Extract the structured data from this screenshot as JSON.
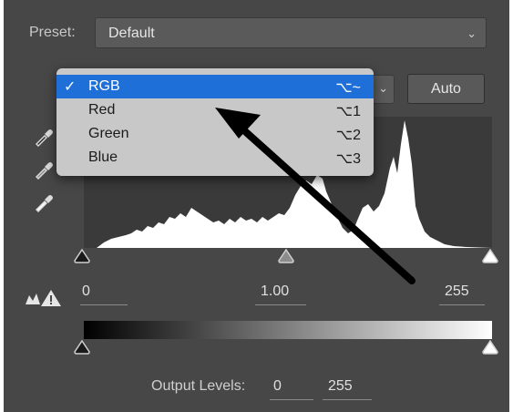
{
  "preset": {
    "label": "Preset:",
    "value": "Default"
  },
  "auto_button": "Auto",
  "channel_menu": {
    "items": [
      {
        "name": "RGB",
        "shortcut": "⌥~",
        "selected": true,
        "check": "✓"
      },
      {
        "name": "Red",
        "shortcut": "⌥1",
        "selected": false,
        "check": ""
      },
      {
        "name": "Green",
        "shortcut": "⌥2",
        "selected": false,
        "check": ""
      },
      {
        "name": "Blue",
        "shortcut": "⌥3",
        "selected": false,
        "check": ""
      }
    ]
  },
  "input_levels": {
    "black": "0",
    "gamma": "1.00",
    "white": "255"
  },
  "output_levels": {
    "label": "Output Levels:",
    "black": "0",
    "white": "255"
  },
  "colors": {
    "panel": "#474747",
    "menu_highlight": "#1f6fd8",
    "menu_bg": "#c8c8c8"
  }
}
